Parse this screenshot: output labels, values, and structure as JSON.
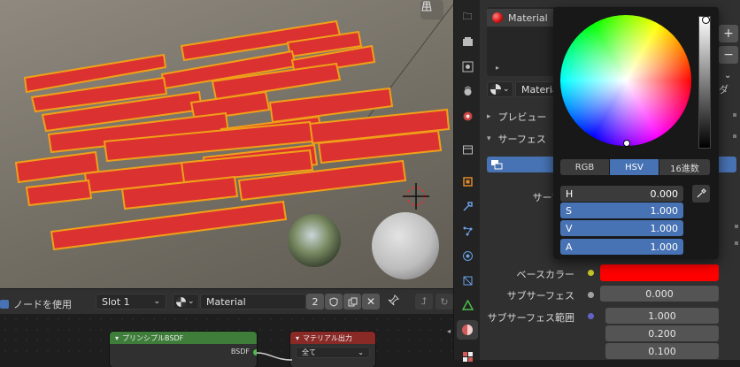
{
  "node_header": {
    "use_nodes_label": "ノードを使用",
    "slot": "Slot 1",
    "material_name": "Material",
    "user_count": "2"
  },
  "nodes": {
    "bsdf_title": "プリンシプルBSDF",
    "bsdf_output": "BSDF",
    "output_title": "マテリアル出力",
    "output_target": "全て"
  },
  "material_panel": {
    "slot_name": "Material",
    "material_field": "Material",
    "preview_label": "プレビュー",
    "surface_label": "サーフェス",
    "surface_row_label": "サーフ"
  },
  "properties": {
    "base_color_label": "ベースカラー",
    "base_color": "#ff0000",
    "subsurface_label": "サブサーフェス",
    "subsurface_value": "0.000",
    "subsurface_radius_label": "サブサーフェス範囲",
    "subsurface_radius_values": [
      "1.000",
      "0.200",
      "0.100"
    ]
  },
  "color_picker": {
    "modes": [
      "RGB",
      "HSV",
      "16進数"
    ],
    "active_mode": "HSV",
    "h_label": "H",
    "h_value": "0.000",
    "s_label": "S",
    "s_value": "1.000",
    "v_label": "V",
    "v_value": "1.000",
    "a_label": "A",
    "a_value": "1.000"
  },
  "colors": {
    "accent": "#4772b3",
    "node_green": "#3e7d3a",
    "node_red": "#8a2a27",
    "socket_yellow": "#c7c729",
    "socket_gray": "#a1a1a1",
    "socket_purple": "#6363c7"
  },
  "icons": [
    "grid-icon",
    "render-icon",
    "output-icon",
    "view-layer-icon",
    "scene-icon",
    "world-icon",
    "object-icon",
    "modifier-icon",
    "particles-icon",
    "physics-icon",
    "constraints-icon",
    "data-icon",
    "material-icon",
    "texture-icon",
    "eyedropper-icon",
    "pin-icon",
    "copy-icon",
    "close-icon",
    "shield-icon"
  ]
}
